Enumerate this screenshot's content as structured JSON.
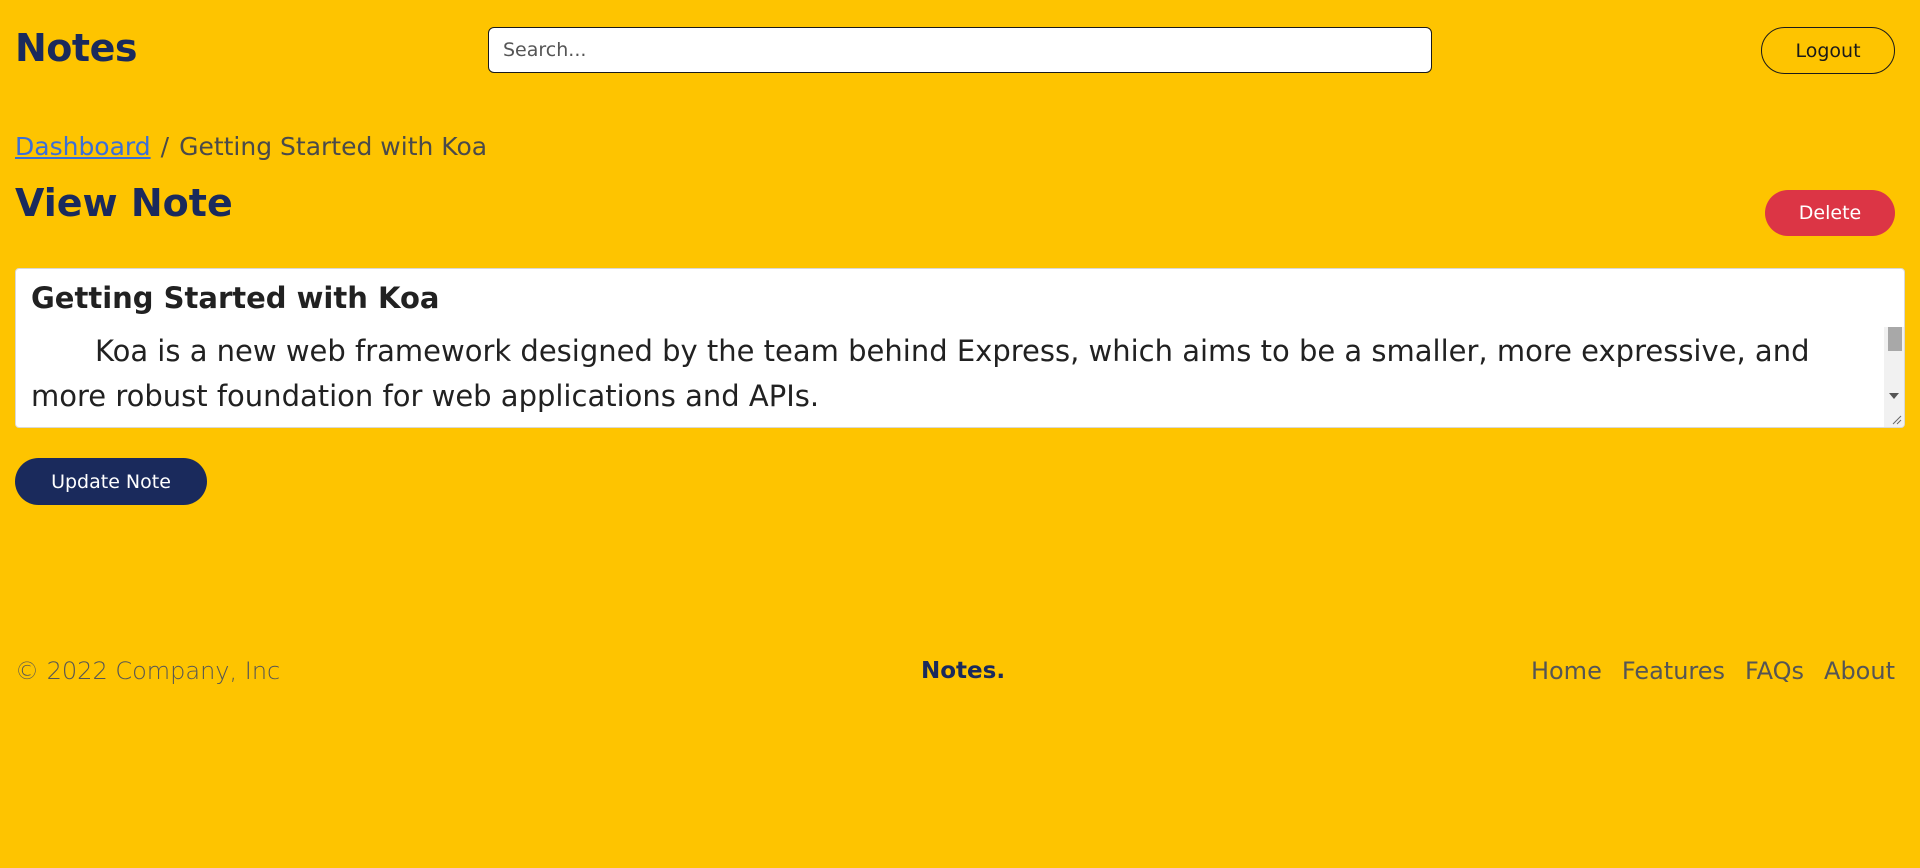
{
  "header": {
    "brand": "Notes",
    "search_placeholder": "Search...",
    "logout_label": "Logout"
  },
  "breadcrumb": {
    "parent": "Dashboard",
    "separator": "/",
    "current": "Getting Started with Koa"
  },
  "page": {
    "title": "View Note",
    "delete_label": "Delete"
  },
  "note": {
    "title": "Getting Started with Koa",
    "body": "Koa is a new web framework designed by the team behind Express, which aims to be a smaller, more expressive, and more robust foundation for web applications and APIs."
  },
  "actions": {
    "update_label": "Update Note"
  },
  "footer": {
    "copyright": "© 2022 Company, Inc",
    "brand": "Notes.",
    "links": [
      "Home",
      "Features",
      "FAQs",
      "About"
    ]
  },
  "colors": {
    "background": "#fec400",
    "primary": "#1a2a5c",
    "danger": "#dc3545",
    "link": "#3a6fd8"
  }
}
